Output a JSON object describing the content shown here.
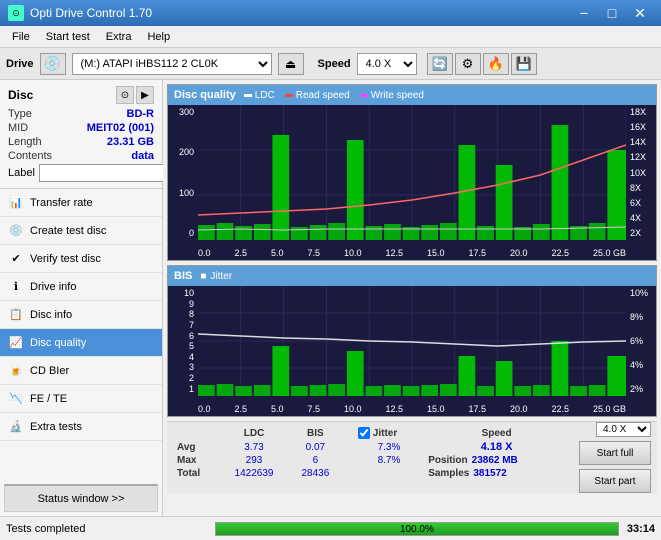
{
  "app": {
    "title": "Opti Drive Control 1.70",
    "icon": "disc"
  },
  "title_bar": {
    "title": "Opti Drive Control 1.70",
    "minimize_label": "−",
    "maximize_label": "□",
    "close_label": "✕"
  },
  "menu": {
    "items": [
      "File",
      "Start test",
      "Extra",
      "Help"
    ]
  },
  "drive_bar": {
    "label": "Drive",
    "drive_value": "(M:) ATAPI iHBS112  2 CL0K",
    "speed_label": "Speed",
    "speed_value": "4.0 X"
  },
  "disc": {
    "title": "Disc",
    "type_label": "Type",
    "type_value": "BD-R",
    "mid_label": "MID",
    "mid_value": "MEIT02 (001)",
    "length_label": "Length",
    "length_value": "23.31 GB",
    "contents_label": "Contents",
    "contents_value": "data",
    "label_label": "Label"
  },
  "nav_items": [
    {
      "id": "transfer-rate",
      "label": "Transfer rate",
      "icon": "📊"
    },
    {
      "id": "create-test-disc",
      "label": "Create test disc",
      "icon": "💿"
    },
    {
      "id": "verify-test-disc",
      "label": "Verify test disc",
      "icon": "✔"
    },
    {
      "id": "drive-info",
      "label": "Drive info",
      "icon": "ℹ"
    },
    {
      "id": "disc-info",
      "label": "Disc info",
      "icon": "📋"
    },
    {
      "id": "disc-quality",
      "label": "Disc quality",
      "icon": "📈",
      "active": true
    },
    {
      "id": "cd-bier",
      "label": "CD BIer",
      "icon": "🍺"
    },
    {
      "id": "fe-te",
      "label": "FE / TE",
      "icon": "📉"
    },
    {
      "id": "extra-tests",
      "label": "Extra tests",
      "icon": "🔬"
    }
  ],
  "status_btn": {
    "label": "Status window >>"
  },
  "chart_top": {
    "title": "Disc quality",
    "legend": [
      {
        "label": "LDC",
        "color": "#ffffff"
      },
      {
        "label": "Read speed",
        "color": "#ff0000"
      },
      {
        "label": "Write speed",
        "color": "#ff00ff"
      }
    ],
    "y_axis_left": [
      "300",
      "200",
      "100",
      "0"
    ],
    "y_axis_right": [
      "18X",
      "16X",
      "14X",
      "12X",
      "10X",
      "8X",
      "6X",
      "4X",
      "2X"
    ],
    "x_axis": [
      "0.0",
      "2.5",
      "5.0",
      "7.5",
      "10.0",
      "12.5",
      "15.0",
      "17.5",
      "20.0",
      "22.5",
      "25.0 GB"
    ]
  },
  "chart_bottom": {
    "title": "BIS",
    "legend2": "Jitter",
    "y_axis_left": [
      "10",
      "9",
      "8",
      "7",
      "6",
      "5",
      "4",
      "3",
      "2",
      "1"
    ],
    "y_axis_right": [
      "10%",
      "8%",
      "6%",
      "4%",
      "2%"
    ],
    "x_axis": [
      "0.0",
      "2.5",
      "5.0",
      "7.5",
      "10.0",
      "12.5",
      "15.0",
      "17.5",
      "20.0",
      "22.5",
      "25.0 GB"
    ]
  },
  "stats": {
    "headers": [
      "LDC",
      "BIS",
      "",
      "Jitter",
      "Speed"
    ],
    "avg_label": "Avg",
    "avg_ldc": "3.73",
    "avg_bis": "0.07",
    "avg_jitter": "7.3%",
    "avg_speed": "4.18 X",
    "max_label": "Max",
    "max_ldc": "293",
    "max_bis": "6",
    "max_jitter": "8.7%",
    "position_label": "Position",
    "position_value": "23862 MB",
    "total_label": "Total",
    "total_ldc": "1422639",
    "total_bis": "28436",
    "samples_label": "Samples",
    "samples_value": "381572",
    "speed_select": "4.0 X",
    "start_full_label": "Start full",
    "start_part_label": "Start part"
  },
  "status_bar": {
    "text": "Tests completed",
    "progress": 100,
    "progress_text": "100.0%",
    "time": "33:14"
  }
}
